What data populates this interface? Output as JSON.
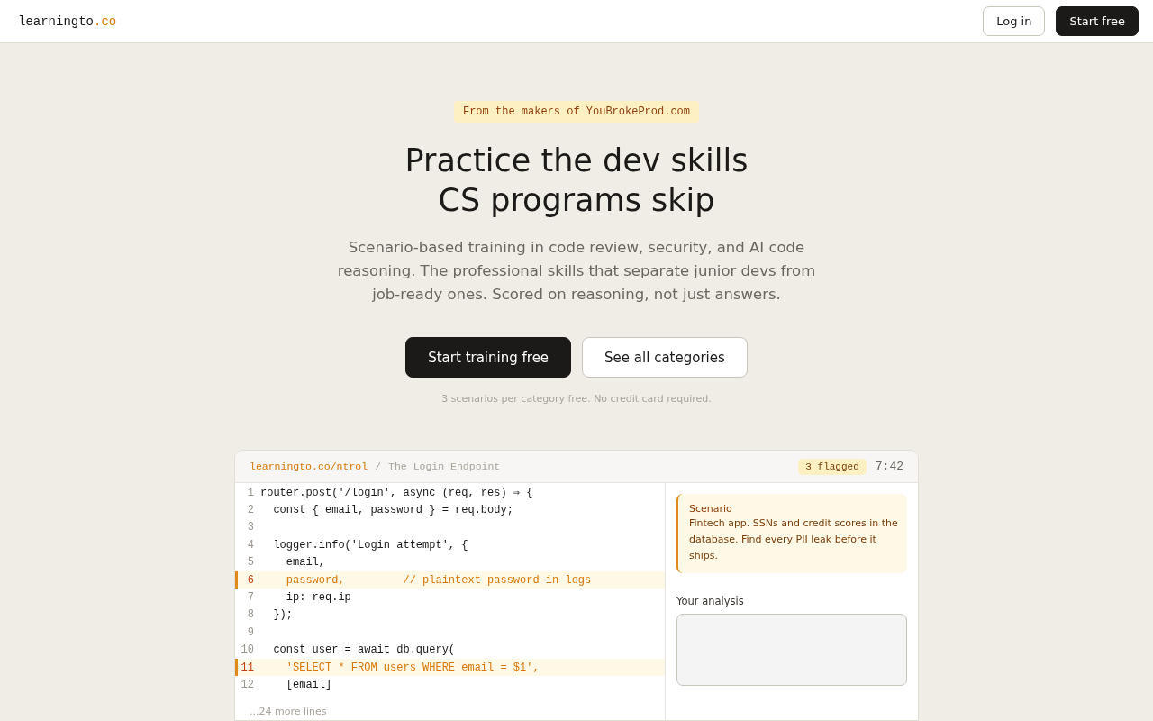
{
  "header": {
    "logo": {
      "name": "learningto",
      "suffix": ".co"
    },
    "buttons": [
      {
        "label": "Log in",
        "kind": "outline"
      },
      {
        "label": "Start free",
        "kind": "solid"
      }
    ]
  },
  "hero": {
    "badge": "From the makers of YouBrokeProd.com",
    "title": [
      "Practice the dev skills",
      "CS programs skip"
    ],
    "subtitle": "Scenario-based training in code review, security, and AI code reasoning. The professional skills that separate junior devs from job-ready ones. Scored on reasoning, not just answers.",
    "buttons": [
      {
        "label": "Start training free",
        "kind": "solid"
      },
      {
        "label": "See all categories",
        "kind": "outline"
      }
    ],
    "note": "3 scenarios per category free. No credit card required."
  },
  "demo": {
    "path": "learningto.co/ntrol",
    "separator": "/",
    "title": "The Login Endpoint",
    "flagged": "3 flagged",
    "timer": "7:42",
    "lines": [
      {
        "number": "1",
        "code": "router.post('/login', async (req, res) ⇒ {",
        "flagged": false
      },
      {
        "number": "2",
        "code": "  const { email, password } = req.body;",
        "flagged": false
      },
      {
        "number": "3",
        "flagged": false
      },
      {
        "number": "4",
        "code": "  logger.info('Login attempt', {",
        "flagged": false
      },
      {
        "number": "5",
        "code": "    email,",
        "flagged": false
      },
      {
        "number": "6",
        "code": "    password,         // plaintext password in logs",
        "flagged": true
      },
      {
        "number": "7",
        "code": "    ip: req.ip",
        "flagged": false
      },
      {
        "number": "8",
        "code": "  });",
        "flagged": false
      },
      {
        "number": "9",
        "flagged": false
      },
      {
        "number": "10",
        "code": "  const user = await db.query(",
        "flagged": false
      },
      {
        "number": "11",
        "code": "    'SELECT * FROM users WHERE email = $1',",
        "flagged": true
      },
      {
        "number": "12",
        "code": "    [email]",
        "flagged": false
      }
    ],
    "more": "...24 more lines",
    "scenario": {
      "label": "Scenario",
      "text": "Fintech app. SSNs and credit scores in the database. Find every PII leak before it ships."
    },
    "analysis_label": "Your analysis"
  }
}
